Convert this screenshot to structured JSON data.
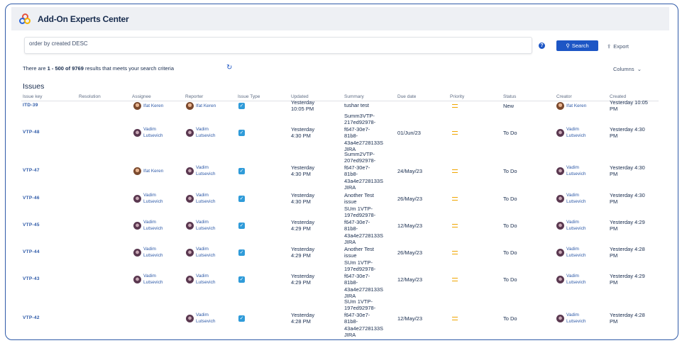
{
  "app": {
    "title": "Add-On Experts Center"
  },
  "search": {
    "query": "order by created DESC",
    "search_label": "Search",
    "export_label": "Export"
  },
  "results": {
    "prefix": "There are ",
    "range": "1 - 500 of 9769",
    "suffix": " results that meets your search criteria",
    "columns_label": "Columns"
  },
  "issues_title": "Issues",
  "columns": [
    "Issue key",
    "Resolution",
    "Assignee",
    "Reporter",
    "Issue Type",
    "Updated",
    "Summary",
    "Due date",
    "Priority",
    "Status",
    "Creator",
    "Created"
  ],
  "rows": [
    {
      "key": "ITD-39",
      "assignee": [
        "Ifat Keren"
      ],
      "reporter": [
        "Ifat Keren"
      ],
      "updated": [
        "Yesterday",
        "10:05 PM"
      ],
      "summary": [
        "tushar test"
      ],
      "due": "",
      "status": "New",
      "creator": [
        "Ifat Keren"
      ],
      "created": [
        "Yesterday 10:05",
        "PM"
      ]
    },
    {
      "key": "VTP-48",
      "assignee": [
        "Vadim",
        "Lutsevich"
      ],
      "reporter": [
        "Vadim",
        "Lutsevich"
      ],
      "updated": [
        "Yesterday",
        "4:30 PM"
      ],
      "summary": [
        "Summ3VTP-",
        "217ed92978-",
        "f647-30e7-",
        "81b8-",
        "43a4e2728133S",
        "JIRA"
      ],
      "due": "01/Jun/23",
      "status": "To Do",
      "creator": [
        "Vadim",
        "Lutsevich"
      ],
      "created": [
        "Yesterday 4:30",
        "PM"
      ]
    },
    {
      "key": "VTP-47",
      "assignee": [
        "Ifat Keren"
      ],
      "reporter": [
        "Vadim",
        "Lutsevich"
      ],
      "updated": [
        "Yesterday",
        "4:30 PM"
      ],
      "summary": [
        "Summ2VTP-",
        "207ed92978-",
        "f647-30e7-",
        "81b8-",
        "43a4e2728133S",
        "JIRA"
      ],
      "due": "24/May/23",
      "status": "To Do",
      "creator": [
        "Vadim",
        "Lutsevich"
      ],
      "created": [
        "Yesterday 4:30",
        "PM"
      ]
    },
    {
      "key": "VTP-46",
      "assignee": [
        "Vadim",
        "Lutsevich"
      ],
      "reporter": [
        "Vadim",
        "Lutsevich"
      ],
      "updated": [
        "Yesterday",
        "4:30 PM"
      ],
      "summary": [
        "Another Test",
        "issue"
      ],
      "due": "26/May/23",
      "status": "To Do",
      "creator": [
        "Vadim",
        "Lutsevich"
      ],
      "created": [
        "Yesterday 4:30",
        "PM"
      ]
    },
    {
      "key": "VTP-45",
      "assignee": [
        "Vadim",
        "Lutsevich"
      ],
      "reporter": [
        "Vadim",
        "Lutsevich"
      ],
      "updated": [
        "Yesterday",
        "4:29 PM"
      ],
      "summary": [
        "SUm 1VTP-",
        "197ed92978-",
        "f647-30e7-",
        "81b8-",
        "43a4e2728133S",
        "JIRA"
      ],
      "due": "12/May/23",
      "status": "To Do",
      "creator": [
        "Vadim",
        "Lutsevich"
      ],
      "created": [
        "Yesterday 4:29",
        "PM"
      ]
    },
    {
      "key": "VTP-44",
      "assignee": [
        "Vadim",
        "Lutsevich"
      ],
      "reporter": [
        "Vadim",
        "Lutsevich"
      ],
      "updated": [
        "Yesterday",
        "4:29 PM"
      ],
      "summary": [
        "Another Test",
        "issue"
      ],
      "due": "26/May/23",
      "status": "To Do",
      "creator": [
        "Vadim",
        "Lutsevich"
      ],
      "created": [
        "Yesterday 4:28",
        "PM"
      ]
    },
    {
      "key": "VTP-43",
      "assignee": [
        "Vadim",
        "Lutsevich"
      ],
      "reporter": [
        "Vadim",
        "Lutsevich"
      ],
      "updated": [
        "Yesterday",
        "4:29 PM"
      ],
      "summary": [
        "SUm 1VTP-",
        "197ed92978-",
        "f647-30e7-",
        "81b8-",
        "43a4e2728133S",
        "JIRA"
      ],
      "due": "12/May/23",
      "status": "To Do",
      "creator": [
        "Vadim",
        "Lutsevich"
      ],
      "created": [
        "Yesterday 4:29",
        "PM"
      ]
    },
    {
      "key": "VTP-42",
      "assignee": [],
      "reporter": [
        "Vadim",
        "Lutsevich"
      ],
      "updated": [
        "Yesterday",
        "4:28 PM"
      ],
      "summary": [
        "SUm 1VTP-",
        "197ed92978-",
        "f647-30e7-",
        "81b8-",
        "43a4e2728133S",
        "JIRA"
      ],
      "due": "12/May/23",
      "status": "To Do",
      "creator": [
        "Vadim",
        "Lutsevich"
      ],
      "created": [
        "Yesterday 4:28",
        "PM"
      ]
    }
  ],
  "colors": {
    "accent": "#1d56c5",
    "link": "#2e5aa8",
    "priority": "#f0a500",
    "issue_type": "#2f9bd9"
  },
  "icons": {
    "logo": "add-on-experts-logo",
    "help": "help-icon",
    "search": "search-icon",
    "export": "export-icon",
    "refresh": "refresh-icon",
    "chevron": "chevron-down-icon",
    "issue_type": "task-checkbox-icon",
    "priority": "priority-medium-icon"
  }
}
